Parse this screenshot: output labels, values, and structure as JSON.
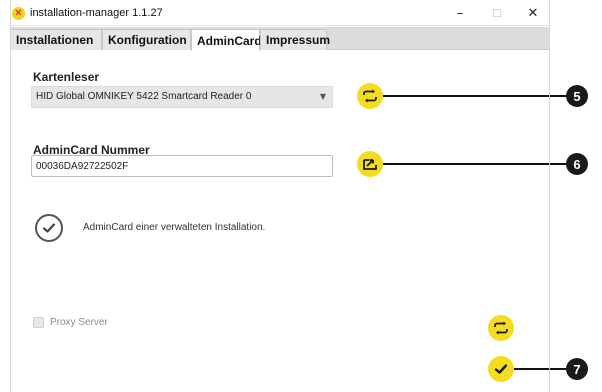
{
  "window": {
    "title": "installation-manager 1.1.27",
    "app_icon_glyph": "✕",
    "controls": {
      "minimize": "–",
      "maximize": "☐",
      "close": "✕"
    }
  },
  "tabs": [
    {
      "label": "Installationen",
      "active": false
    },
    {
      "label": "Konfiguration",
      "active": false
    },
    {
      "label": "AdminCard",
      "active": true
    },
    {
      "label": "Impressum",
      "active": false
    }
  ],
  "card_reader": {
    "label": "Kartenleser",
    "selected": "HID Global OMNIKEY 5422 Smartcard Reader 0",
    "arrow": "▼",
    "refresh_icon": "refresh-icon"
  },
  "admincard": {
    "label": "AdminCard Nummer",
    "value": "00036DA92722502F",
    "import_icon": "card-import-icon"
  },
  "status": {
    "text": "AdminCard einer verwalteten Installation."
  },
  "proxy": {
    "label": "Proxy Server",
    "checked": false
  },
  "callouts": [
    "5",
    "6",
    "7"
  ],
  "colors": {
    "accent_yellow": "#f5dc1e",
    "callout_dark": "#1a1a1a",
    "tab_bar": "#dcdcdc"
  }
}
